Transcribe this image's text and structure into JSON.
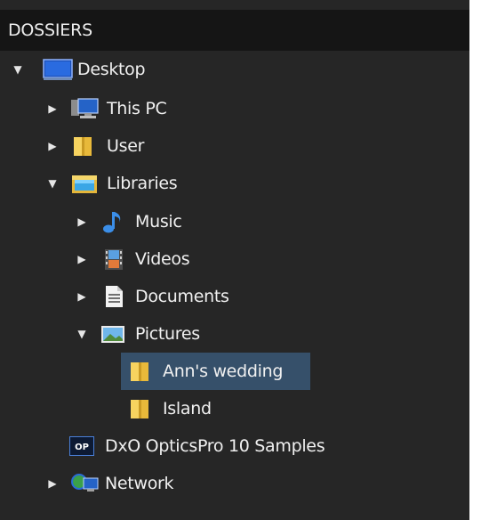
{
  "header": {
    "title": "DOSSIERS"
  },
  "tree": {
    "desktop": "Desktop",
    "this_pc": "This PC",
    "user": "User",
    "libraries": "Libraries",
    "music": "Music",
    "videos": "Videos",
    "documents": "Documents",
    "pictures": "Pictures",
    "anns_wedding": "Ann's wedding",
    "island": "Island",
    "dxo_samples": "DxO OpticsPro 10 Samples",
    "network": "Network"
  },
  "icons": {
    "dxo_badge_text": "OP"
  },
  "colors": {
    "panel_bg": "#262626",
    "header_bg": "#151515",
    "selection_bg": "#36506a",
    "text": "#f0f0f0"
  },
  "selected_item": "Ann's wedding"
}
